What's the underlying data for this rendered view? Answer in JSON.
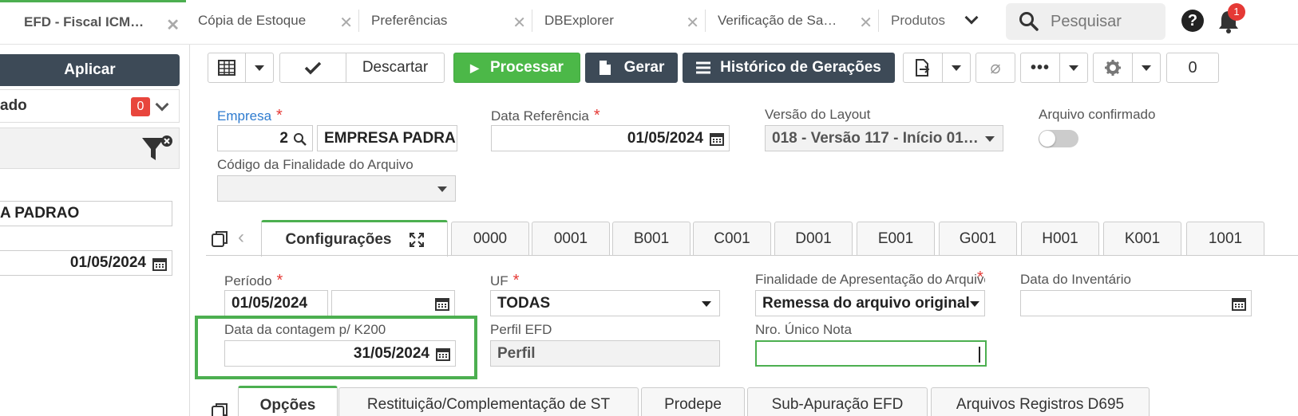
{
  "top_tabs": [
    {
      "label": "EFD - Fiscal ICM…",
      "active": true
    },
    {
      "label": "Cópia de Estoque"
    },
    {
      "label": "Preferências"
    },
    {
      "label": "DBExplorer"
    },
    {
      "label": "Verificação de Sa…"
    },
    {
      "label": "Produtos"
    }
  ],
  "search": {
    "placeholder": "Pesquisar"
  },
  "notifications": {
    "count": "1"
  },
  "left": {
    "apply_label": "Aplicar",
    "row_label": "ado",
    "row_badge": "0",
    "field1_value": "A PADRAO",
    "field2_value": "01/05/2024"
  },
  "toolbar": {
    "discard_label": "Descartar",
    "process_label": "Processar",
    "generate_label": "Gerar",
    "history_label": "Histórico de Gerações",
    "counter": "0"
  },
  "form": {
    "empresa_label": "Empresa",
    "empresa_code": "2",
    "empresa_name": "EMPRESA PADRA",
    "data_ref_label": "Data Referência",
    "data_ref_value": "01/05/2024",
    "versao_label": "Versão do Layout",
    "versao_value": "018 - Versão 117 - Início 01/…",
    "arquivo_confirmado_label": "Arquivo confirmado",
    "codigo_finalidade_label": "Código da Finalidade do Arquivo"
  },
  "subtabs": [
    {
      "label": "Configurações",
      "active": true
    },
    {
      "label": "0000"
    },
    {
      "label": "0001"
    },
    {
      "label": "B001"
    },
    {
      "label": "C001"
    },
    {
      "label": "D001"
    },
    {
      "label": "E001"
    },
    {
      "label": "G001"
    },
    {
      "label": "H001"
    },
    {
      "label": "K001"
    },
    {
      "label": "1001"
    }
  ],
  "config": {
    "periodo_label": "Período",
    "periodo_start": "01/05/2024",
    "periodo_end": "",
    "uf_label": "UF",
    "uf_value": "TODAS",
    "finalidade_label": "Finalidade de Apresentação do Arquivo",
    "finalidade_value": "Remessa do arquivo original",
    "data_inventario_label": "Data do Inventário",
    "data_contagem_label": "Data da contagem p/ K200",
    "data_contagem_value": "31/05/2024",
    "perfil_label": "Perfil EFD",
    "perfil_value": "Perfil",
    "nro_unico_label": "Nro. Único Nota"
  },
  "bottom_tabs": [
    {
      "label": "Opções"
    },
    {
      "label": "Restituição/Complementação de ST"
    },
    {
      "label": "Prodepe"
    },
    {
      "label": "Sub-Apuração EFD"
    },
    {
      "label": "Arquivos Registros D695"
    }
  ],
  "colors": {
    "accent": "#4caf50",
    "dark": "#3d4a57",
    "required": "#e53935",
    "link": "#2e7bcf"
  }
}
